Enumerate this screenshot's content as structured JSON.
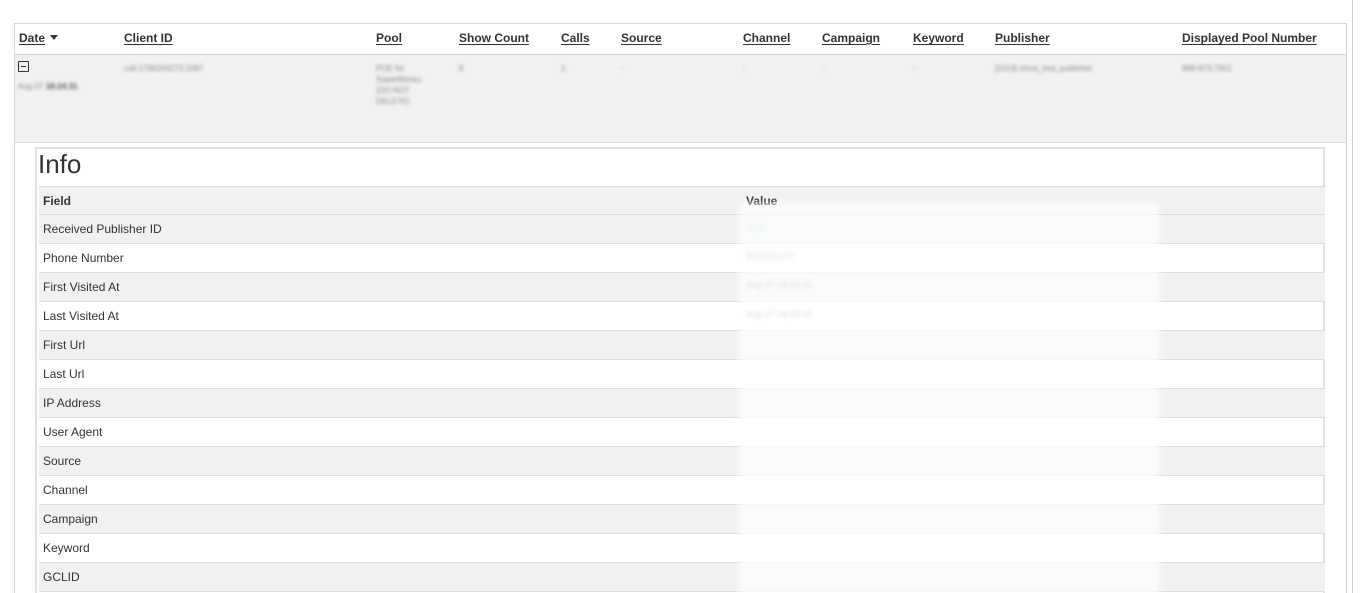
{
  "table": {
    "headers": {
      "date": "Date",
      "client_id": "Client ID",
      "pool": "Pool",
      "show_count": "Show Count",
      "calls": "Calls",
      "source": "Source",
      "channel": "Channel",
      "campaign": "Campaign",
      "keyword": "Keyword",
      "publisher": "Publisher",
      "displayed_pool_number": "Displayed Pool Number"
    },
    "row": {
      "date_day": "Aug 07",
      "date_time": "18:24:31",
      "client_id": "call-1786243273.1097",
      "pool": "POE for SuperMoney (DO NOT DELETE)",
      "show_count": "8",
      "calls": "1",
      "source": "-",
      "channel": "-",
      "campaign": "-",
      "keyword": "-",
      "publisher": "[1019] show_test_publisher",
      "displayed_pool_number": "888-873-7501"
    }
  },
  "info": {
    "title": "Info",
    "headers": {
      "field": "Field",
      "value": "Value"
    },
    "rows": [
      {
        "field": "Received Publisher ID",
        "value": "1019"
      },
      {
        "field": "Phone Number",
        "value": "8221111172"
      },
      {
        "field": "First Visited At",
        "value": "Aug 07 18:24:31"
      },
      {
        "field": "Last Visited At",
        "value": "Aug 07 18:24:31"
      },
      {
        "field": "First Url",
        "value": ""
      },
      {
        "field": "Last Url",
        "value": ""
      },
      {
        "field": "IP Address",
        "value": ""
      },
      {
        "field": "User Agent",
        "value": ""
      },
      {
        "field": "Source",
        "value": ""
      },
      {
        "field": "Channel",
        "value": ""
      },
      {
        "field": "Campaign",
        "value": ""
      },
      {
        "field": "Keyword",
        "value": ""
      },
      {
        "field": "GCLID",
        "value": ""
      }
    ]
  },
  "colors": {
    "header_bg": "#ffffff",
    "row_bg": "#f1f1f1",
    "border": "#d6d6d6",
    "text": "#333333",
    "publisher_id_value": "#7ed3a4"
  },
  "icons": {
    "row_toggle": "minus-square-icon",
    "sort": "caret-down-icon"
  }
}
